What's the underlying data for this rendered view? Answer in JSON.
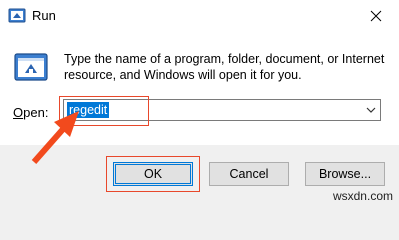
{
  "window": {
    "title": "Run",
    "close_symbol": "✕"
  },
  "dialog": {
    "description": "Type the name of a program, folder, document, or Internet resource, and Windows will open it for you.",
    "open_label_accel": "O",
    "open_label_rest": "pen:",
    "open_value": "regedit"
  },
  "buttons": {
    "ok": "OK",
    "cancel": "Cancel",
    "browse": "Browse..."
  },
  "watermark": "wsxdn.com",
  "colors": {
    "highlight": "#0078d7",
    "callout": "#e8482b"
  },
  "icons": [
    "run-app-icon",
    "run-large-icon",
    "close-icon",
    "chevron-down-icon",
    "callout-arrow-icon"
  ]
}
